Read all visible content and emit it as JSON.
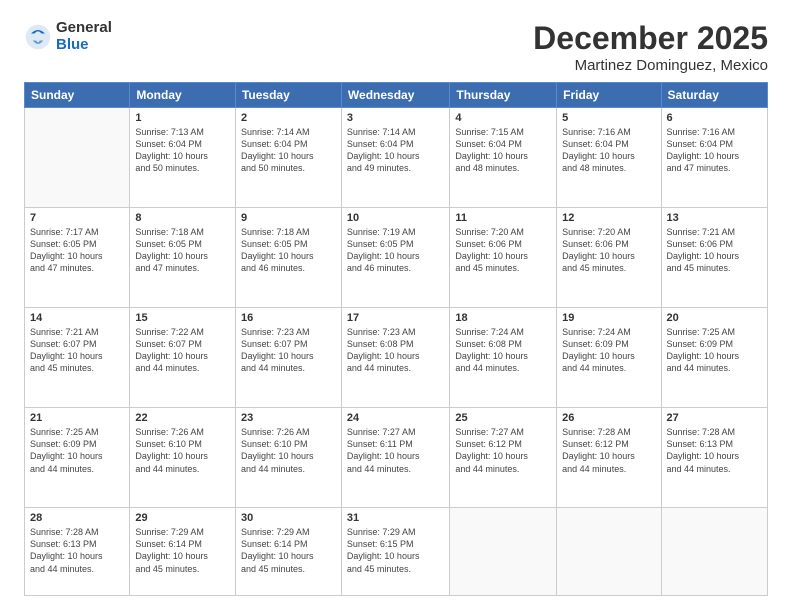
{
  "header": {
    "logo_general": "General",
    "logo_blue": "Blue",
    "month": "December 2025",
    "location": "Martinez Dominguez, Mexico"
  },
  "days_of_week": [
    "Sunday",
    "Monday",
    "Tuesday",
    "Wednesday",
    "Thursday",
    "Friday",
    "Saturday"
  ],
  "weeks": [
    [
      {
        "day": "",
        "info": ""
      },
      {
        "day": "1",
        "info": "Sunrise: 7:13 AM\nSunset: 6:04 PM\nDaylight: 10 hours\nand 50 minutes."
      },
      {
        "day": "2",
        "info": "Sunrise: 7:14 AM\nSunset: 6:04 PM\nDaylight: 10 hours\nand 50 minutes."
      },
      {
        "day": "3",
        "info": "Sunrise: 7:14 AM\nSunset: 6:04 PM\nDaylight: 10 hours\nand 49 minutes."
      },
      {
        "day": "4",
        "info": "Sunrise: 7:15 AM\nSunset: 6:04 PM\nDaylight: 10 hours\nand 48 minutes."
      },
      {
        "day": "5",
        "info": "Sunrise: 7:16 AM\nSunset: 6:04 PM\nDaylight: 10 hours\nand 48 minutes."
      },
      {
        "day": "6",
        "info": "Sunrise: 7:16 AM\nSunset: 6:04 PM\nDaylight: 10 hours\nand 47 minutes."
      }
    ],
    [
      {
        "day": "7",
        "info": "Sunrise: 7:17 AM\nSunset: 6:05 PM\nDaylight: 10 hours\nand 47 minutes."
      },
      {
        "day": "8",
        "info": "Sunrise: 7:18 AM\nSunset: 6:05 PM\nDaylight: 10 hours\nand 47 minutes."
      },
      {
        "day": "9",
        "info": "Sunrise: 7:18 AM\nSunset: 6:05 PM\nDaylight: 10 hours\nand 46 minutes."
      },
      {
        "day": "10",
        "info": "Sunrise: 7:19 AM\nSunset: 6:05 PM\nDaylight: 10 hours\nand 46 minutes."
      },
      {
        "day": "11",
        "info": "Sunrise: 7:20 AM\nSunset: 6:06 PM\nDaylight: 10 hours\nand 45 minutes."
      },
      {
        "day": "12",
        "info": "Sunrise: 7:20 AM\nSunset: 6:06 PM\nDaylight: 10 hours\nand 45 minutes."
      },
      {
        "day": "13",
        "info": "Sunrise: 7:21 AM\nSunset: 6:06 PM\nDaylight: 10 hours\nand 45 minutes."
      }
    ],
    [
      {
        "day": "14",
        "info": "Sunrise: 7:21 AM\nSunset: 6:07 PM\nDaylight: 10 hours\nand 45 minutes."
      },
      {
        "day": "15",
        "info": "Sunrise: 7:22 AM\nSunset: 6:07 PM\nDaylight: 10 hours\nand 44 minutes."
      },
      {
        "day": "16",
        "info": "Sunrise: 7:23 AM\nSunset: 6:07 PM\nDaylight: 10 hours\nand 44 minutes."
      },
      {
        "day": "17",
        "info": "Sunrise: 7:23 AM\nSunset: 6:08 PM\nDaylight: 10 hours\nand 44 minutes."
      },
      {
        "day": "18",
        "info": "Sunrise: 7:24 AM\nSunset: 6:08 PM\nDaylight: 10 hours\nand 44 minutes."
      },
      {
        "day": "19",
        "info": "Sunrise: 7:24 AM\nSunset: 6:09 PM\nDaylight: 10 hours\nand 44 minutes."
      },
      {
        "day": "20",
        "info": "Sunrise: 7:25 AM\nSunset: 6:09 PM\nDaylight: 10 hours\nand 44 minutes."
      }
    ],
    [
      {
        "day": "21",
        "info": "Sunrise: 7:25 AM\nSunset: 6:09 PM\nDaylight: 10 hours\nand 44 minutes."
      },
      {
        "day": "22",
        "info": "Sunrise: 7:26 AM\nSunset: 6:10 PM\nDaylight: 10 hours\nand 44 minutes."
      },
      {
        "day": "23",
        "info": "Sunrise: 7:26 AM\nSunset: 6:10 PM\nDaylight: 10 hours\nand 44 minutes."
      },
      {
        "day": "24",
        "info": "Sunrise: 7:27 AM\nSunset: 6:11 PM\nDaylight: 10 hours\nand 44 minutes."
      },
      {
        "day": "25",
        "info": "Sunrise: 7:27 AM\nSunset: 6:12 PM\nDaylight: 10 hours\nand 44 minutes."
      },
      {
        "day": "26",
        "info": "Sunrise: 7:28 AM\nSunset: 6:12 PM\nDaylight: 10 hours\nand 44 minutes."
      },
      {
        "day": "27",
        "info": "Sunrise: 7:28 AM\nSunset: 6:13 PM\nDaylight: 10 hours\nand 44 minutes."
      }
    ],
    [
      {
        "day": "28",
        "info": "Sunrise: 7:28 AM\nSunset: 6:13 PM\nDaylight: 10 hours\nand 44 minutes."
      },
      {
        "day": "29",
        "info": "Sunrise: 7:29 AM\nSunset: 6:14 PM\nDaylight: 10 hours\nand 45 minutes."
      },
      {
        "day": "30",
        "info": "Sunrise: 7:29 AM\nSunset: 6:14 PM\nDaylight: 10 hours\nand 45 minutes."
      },
      {
        "day": "31",
        "info": "Sunrise: 7:29 AM\nSunset: 6:15 PM\nDaylight: 10 hours\nand 45 minutes."
      },
      {
        "day": "",
        "info": ""
      },
      {
        "day": "",
        "info": ""
      },
      {
        "day": "",
        "info": ""
      }
    ]
  ]
}
